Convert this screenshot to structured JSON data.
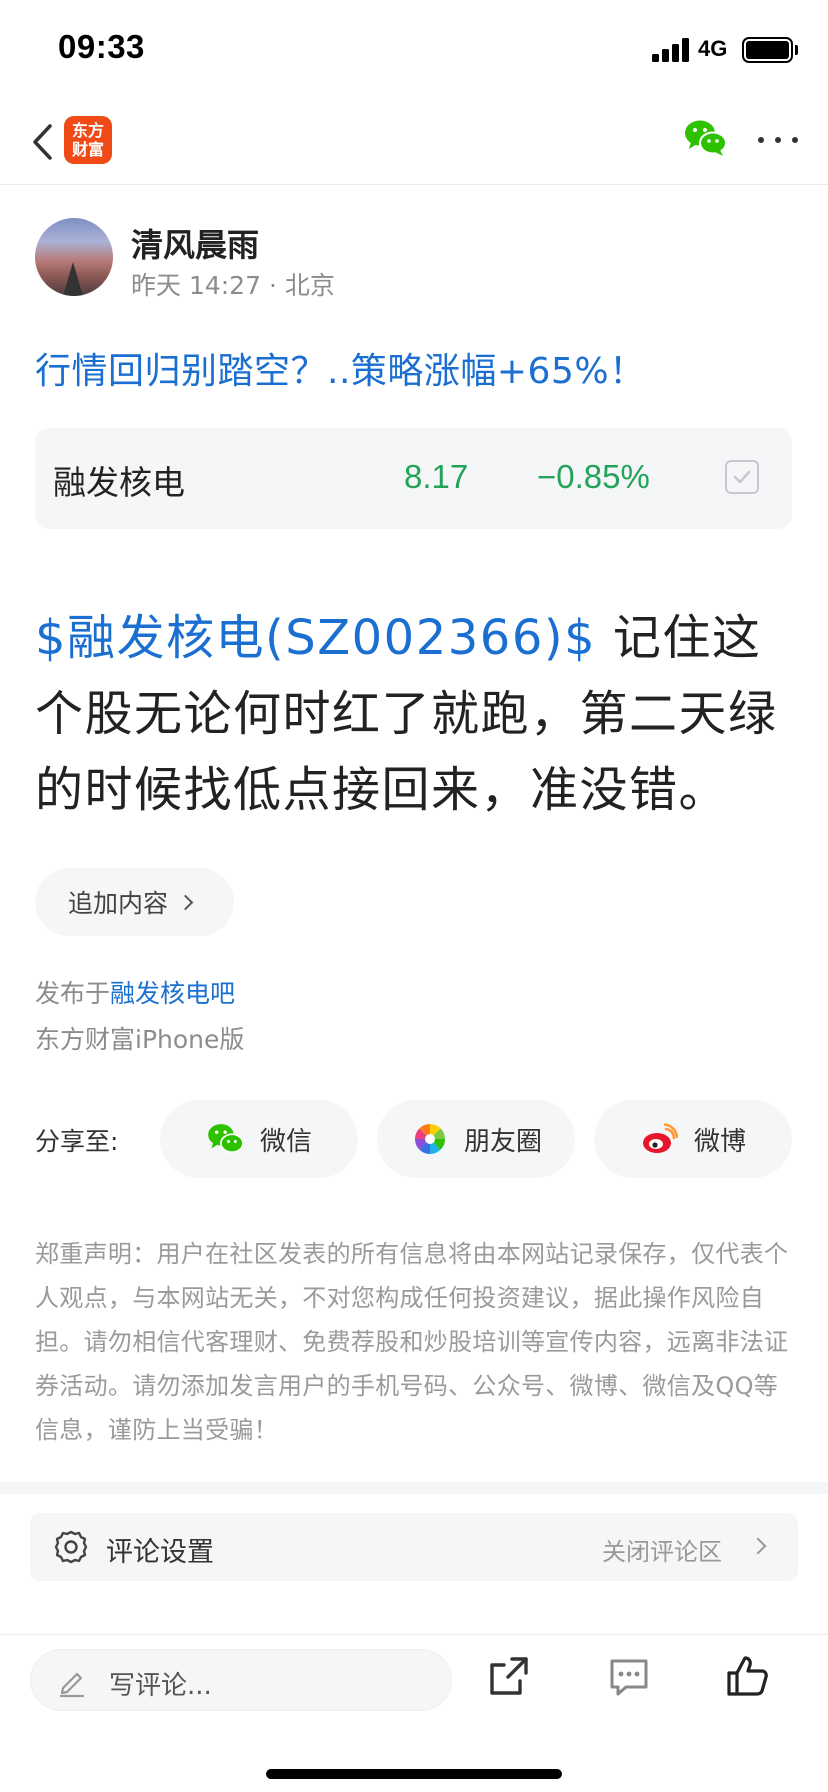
{
  "status_bar": {
    "time": "09:33",
    "network": "4G"
  },
  "navbar": {
    "logo_line1": "东方",
    "logo_line2": "财富"
  },
  "author": {
    "name": "清风晨雨",
    "meta": "昨天 14:27 · 北京"
  },
  "post": {
    "title": "行情回归别踏空？..策略涨幅+65%！",
    "stock_link": "$融发核电(SZ002366)$",
    "body": " 记住这个股无论何时红了就跑，第二天绿的时候找低点接回来，准没错。"
  },
  "stock_card": {
    "name": "融发核电",
    "price": "8.17",
    "change": "−0.85%",
    "color": "#23a35a"
  },
  "add_content": {
    "label": "追加内容"
  },
  "published": {
    "prefix": "发布于",
    "bar_name": "融发核电吧",
    "client": "东方财富iPhone版"
  },
  "share": {
    "label": "分享至:",
    "options": [
      {
        "label": "微信",
        "icon": "wechat-icon"
      },
      {
        "label": "朋友圈",
        "icon": "moments-icon"
      },
      {
        "label": "微博",
        "icon": "weibo-icon"
      }
    ]
  },
  "disclaimer": "郑重声明：用户在社区发表的所有信息将由本网站记录保存，仅代表个人观点，与本网站无关，不对您构成任何投资建议，据此操作风险自担。请勿相信代客理财、免费荐股和炒股培训等宣传内容，远离非法证券活动。请勿添加发言用户的手机号码、公众号、微博、微信及QQ等信息，谨防上当受骗！",
  "comment_settings": {
    "label": "评论设置",
    "action": "关闭评论区"
  },
  "bottom_bar": {
    "placeholder": "写评论..."
  },
  "colors": {
    "link_blue": "#1a6fd1",
    "down_green": "#23a35a",
    "brand_orange": "#f04a17"
  }
}
